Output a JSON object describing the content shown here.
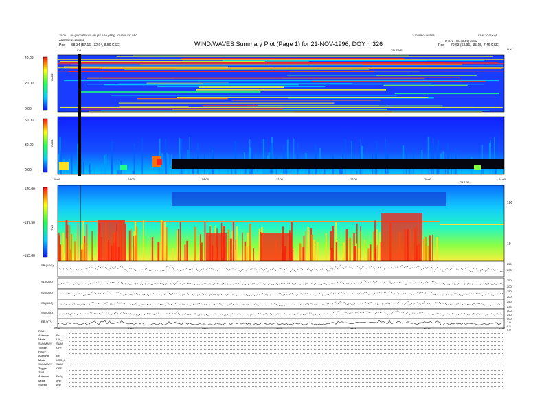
{
  "header": {
    "title": "WIND/WAVES Summary Plot (Page 1) for 21-NOV-1996, DOY = 326",
    "top_left_line1": "15:00 - 1:00 (2000 SFC/15 SP (7S 1:60 (IFR)) - G 1500 SC SPC",
    "top_left_line2": "ABORSE 2=13:0851",
    "pos_left_label": "Pos",
    "pos_left_value": "68.34 (57.16, -32.94, 8.50 GSE)",
    "top_right_line0": "1:10 WSO OUT03",
    "top_right_line0b": "L3 8170:01a:01",
    "top_right_line1": "D 5L V 1T03 (5/3/1) 25452",
    "pos_right_label": "Pos",
    "pos_right_value": "70.63 (53.96, -35.15, 7.46 GSE)",
    "right_marker": "kHz",
    "marker_c": "Cal"
  },
  "chart_data": [
    {
      "panel": "RAD2",
      "type": "heatmap",
      "ylabel": "RAD2",
      "colorbar_ticks": [
        "40.00",
        "20.00",
        "0.00"
      ],
      "top_axis_label": "TELSINE",
      "x_ticks": []
    },
    {
      "panel": "RAD1",
      "type": "heatmap",
      "ylabel": "RAD1",
      "colorbar_ticks": [
        "60.00",
        "30.00",
        "0.00"
      ],
      "x_ticks": [
        "00:00",
        "04:00",
        "08:00",
        "12:00",
        "16:00",
        "20:00",
        "24:00"
      ]
    },
    {
      "panel": "TNR",
      "type": "heatmap",
      "ylabel": "TNR",
      "colorbar_ticks": [
        "-120.00",
        "-137.50",
        "-155.00"
      ],
      "right_ticks": [
        "100",
        "10"
      ],
      "top_right_label": "G8 1/34 1"
    },
    {
      "type": "line",
      "panels": [
        {
          "label": "SB (KGC)",
          "right_ticks": [
            "250",
            "200"
          ]
        },
        {
          "label": "S1 (KGC)",
          "right_ticks": [
            "250",
            "200"
          ]
        },
        {
          "label": "S2 (KGC)",
          "right_ticks": [
            "250",
            "200"
          ]
        },
        {
          "label": "S3 (KGC)",
          "right_ticks": [
            "250",
            "200"
          ]
        },
        {
          "label": "S4 (KGC)",
          "right_ticks": [
            "500",
            "250",
            "000"
          ]
        },
        {
          "label": "RB (YT)",
          "right_ticks": [
            "1.0",
            "0.5",
            "0.0"
          ]
        }
      ],
      "x_ticks": [
        "0000",
        "0400",
        "0800",
        "1200",
        "1600",
        "2000",
        "2400"
      ]
    }
  ],
  "footer": {
    "lines": [
      [
        "RAD1",
        ""
      ],
      [
        "Antenna",
        "Ex"
      ],
      [
        "Mode",
        "LIN_1"
      ],
      [
        "SUMMARY",
        "SUM"
      ],
      [
        "Toggle",
        "OFF"
      ],
      [
        "RAD2",
        ""
      ],
      [
        "Antenna",
        "Ex"
      ],
      [
        "Mode",
        "LOG_A"
      ],
      [
        "SUMMARY",
        "SUM"
      ],
      [
        "Toggle",
        "OFF"
      ],
      [
        "TNR",
        ""
      ],
      [
        "Antenna",
        "ExEy"
      ],
      [
        "Mode",
        "A/D"
      ],
      [
        "Sweep",
        "A/D"
      ]
    ]
  }
}
